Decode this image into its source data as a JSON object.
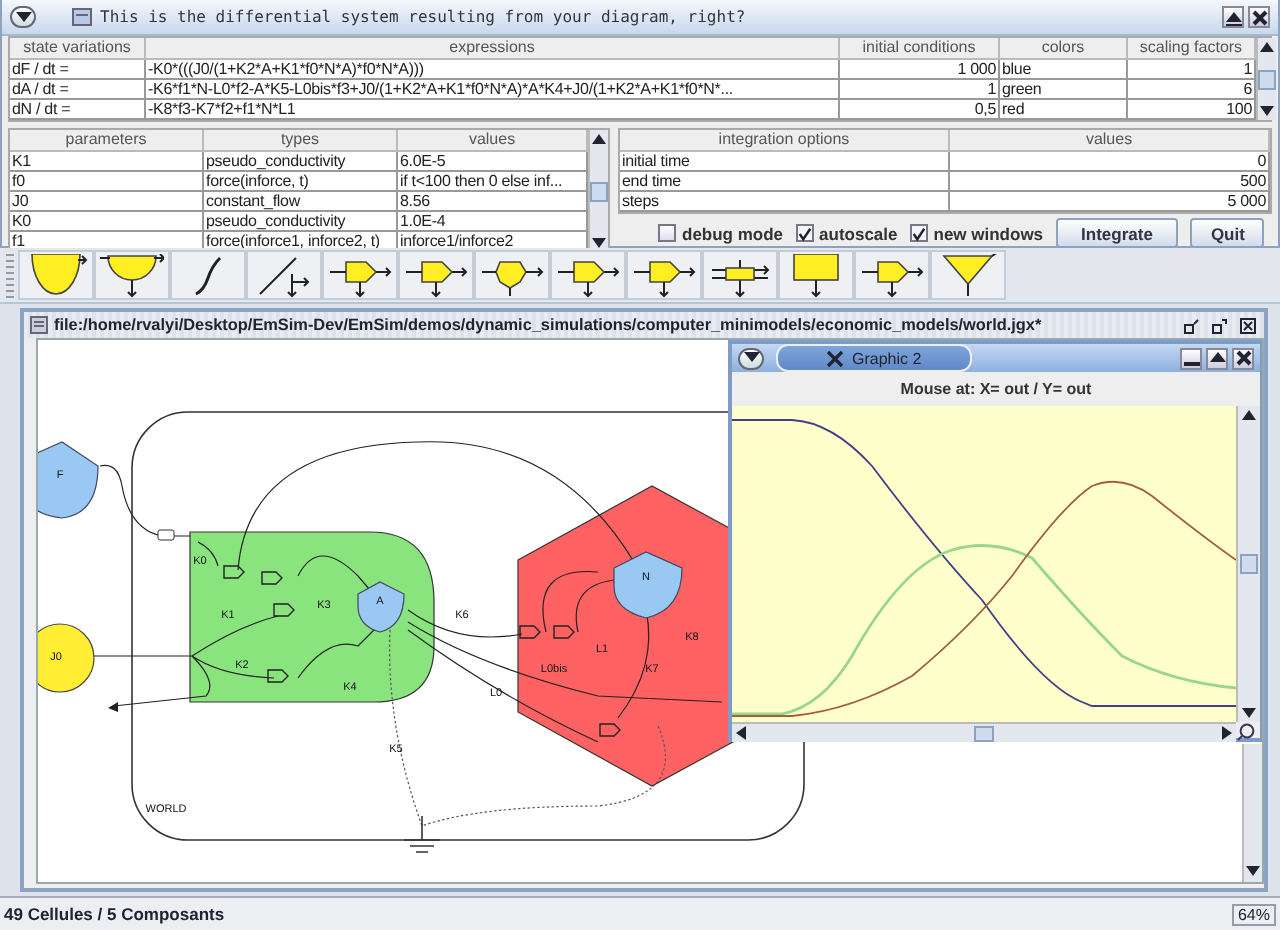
{
  "dialog": {
    "title": "This is the differential system resulting from your diagram, right?"
  },
  "equations": {
    "columns": [
      "state variations",
      "expressions",
      "initial conditions",
      "colors",
      "scaling factors"
    ],
    "rows": [
      {
        "variation": "dF / dt =",
        "expression": "-K0*(((J0/(1+K2*A+K1*f0*N*A)*f0*N*A)))",
        "initial": "1 000",
        "color_name": "blue",
        "scale": "1"
      },
      {
        "variation": "dA / dt =",
        "expression": "-K6*f1*N-L0*f2-A*K5-L0bis*f3+J0/(1+K2*A+K1*f0*N*A)*A*K4+J0/(1+K2*A+K1*f0*N*...",
        "initial": "1",
        "color_name": "green",
        "scale": "6"
      },
      {
        "variation": "dN / dt =",
        "expression": "-K8*f3-K7*f2+f1*N*L1",
        "initial": "0,5",
        "color_name": "red",
        "scale": "100"
      }
    ]
  },
  "parameters": {
    "columns": [
      "parameters",
      "types",
      "values"
    ],
    "rows": [
      {
        "name": "K1",
        "type": "pseudo_conductivity",
        "value": "6.0E-5"
      },
      {
        "name": "f0",
        "type": "force(inforce, t)",
        "value": "if t<100 then 0 else inf..."
      },
      {
        "name": "J0",
        "type": "constant_flow",
        "value": "8.56"
      },
      {
        "name": "K0",
        "type": "pseudo_conductivity",
        "value": "1.0E-4"
      },
      {
        "name": "f1",
        "type": "force(inforce1, inforce2, t)",
        "value": "inforce1/inforce2"
      }
    ]
  },
  "integration": {
    "columns": [
      "integration options",
      "values"
    ],
    "rows": [
      {
        "option": "initial time",
        "value": "0"
      },
      {
        "option": "end time",
        "value": "500"
      },
      {
        "option": "steps",
        "value": "5 000"
      }
    ]
  },
  "options": {
    "checkboxes": [
      {
        "label": "debug mode",
        "checked": false
      },
      {
        "label": "autoscale",
        "checked": true
      },
      {
        "label": "new windows",
        "checked": true
      }
    ],
    "buttons": [
      "Integrate",
      "Quit"
    ]
  },
  "document": {
    "title": "file:/home/rvalyi/Desktop/EmSim-Dev/EmSim/demos/dynamic_simulations/computer_minimodels/economic_models/world.jgx*",
    "diagram_labels": [
      "F",
      "K0",
      "N",
      "K3",
      "A",
      "K1",
      "K6",
      "K8",
      "L1",
      "J0",
      "K2",
      "L0bis",
      "K7",
      "K4",
      "L0",
      "K5",
      "WORLD"
    ]
  },
  "graph_window": {
    "title": "Graphic 2",
    "mouse_readout": "Mouse at:  X= out  /  Y= out"
  },
  "status_bar": {
    "counts": "49 Cellules / 5 Composants",
    "zoom": "64%"
  }
}
